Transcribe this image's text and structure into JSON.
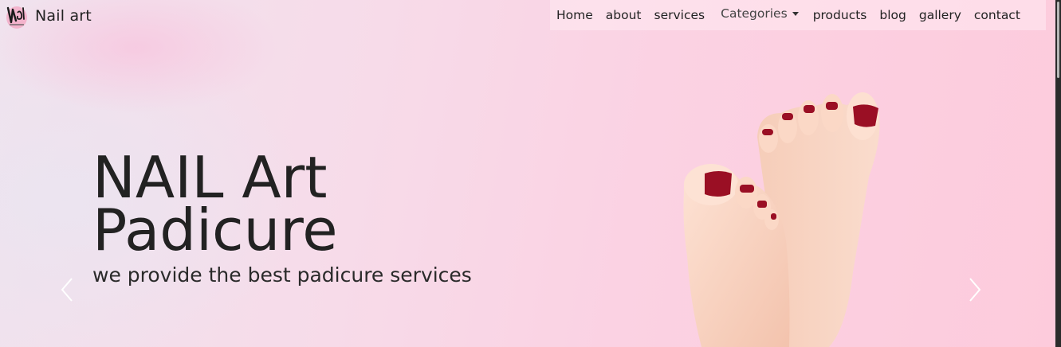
{
  "brand": {
    "name": "Nail art",
    "logo_icon": "nail-art-logo"
  },
  "nav": {
    "items": [
      "Home",
      "about",
      "services"
    ],
    "dropdown_label": "Categories",
    "items_after": [
      "products",
      "blog",
      "gallery",
      "contact"
    ]
  },
  "hero": {
    "title_line1": "NAIL Art",
    "title_line2": "Padicure",
    "tagline": "we provide the best padicure services",
    "prev_icon": "chevron-left-icon",
    "next_icon": "chevron-right-icon"
  },
  "colors": {
    "text": "#222222",
    "nail_polish": "#9a0f24",
    "hero_pink": "#fcd0e1"
  }
}
